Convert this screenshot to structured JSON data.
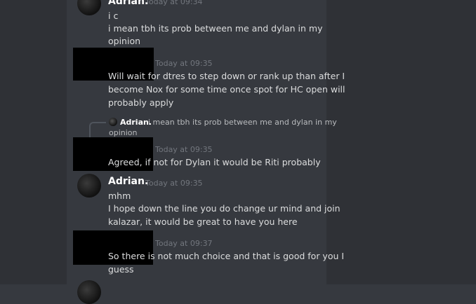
{
  "messages": [
    {
      "author": "Adrian.",
      "timestamp": "Today at 09:34",
      "lines": [
        "i c",
        "i mean tbh its prob between me and dylan in my",
        "opinion"
      ]
    },
    {
      "author": "",
      "timestamp": "Today at 09:35",
      "lines": [
        "Will wait for dtres to step down or rank up than after I",
        "become Nox for some time once spot for HC open will",
        "probably apply"
      ]
    },
    {
      "reply": {
        "author": "Adrian.",
        "lines": [
          "i mean tbh its prob between me and dylan in my",
          "opinion"
        ]
      },
      "author": "",
      "timestamp": "Today at 09:35",
      "lines": [
        "Agreed, if not for Dylan it would be Riti probably"
      ]
    },
    {
      "author": "Adrian.",
      "timestamp": "Today at 09:35",
      "lines": [
        "mhm",
        "I hope down the line you do change ur mind and join",
        "kalazar, it would be great to have you here"
      ]
    },
    {
      "author": "",
      "timestamp": "Today at 09:37",
      "lines": [
        "So there is not much choice and that is good for you I",
        "guess"
      ]
    }
  ]
}
